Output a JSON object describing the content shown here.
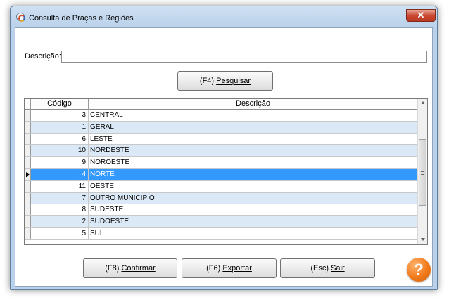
{
  "window": {
    "title": "Consulta de Praças e Regiões",
    "close_label": "✕"
  },
  "search": {
    "label": "Descrição:",
    "value": "",
    "placeholder": "",
    "button_prefix": "(F4) ",
    "button_label": "Pesquisar"
  },
  "grid": {
    "columns": [
      "Código",
      "Descrição"
    ],
    "selected_index": 5,
    "rows": [
      {
        "code": "3",
        "description": "CENTRAL"
      },
      {
        "code": "1",
        "description": "GERAL"
      },
      {
        "code": "6",
        "description": "LESTE"
      },
      {
        "code": "10",
        "description": "NORDESTE"
      },
      {
        "code": "9",
        "description": "NOROESTE"
      },
      {
        "code": "4",
        "description": "NORTE"
      },
      {
        "code": "11",
        "description": "OESTE"
      },
      {
        "code": "7",
        "description": "OUTRO MUNICIPIO"
      },
      {
        "code": "8",
        "description": "SUDESTE"
      },
      {
        "code": "2",
        "description": "SUDOESTE"
      },
      {
        "code": "5",
        "description": "SUL"
      }
    ]
  },
  "footer": {
    "confirm_prefix": "(F8) ",
    "confirm_label": "Confirmar",
    "export_prefix": "(F6) ",
    "export_label": "Exportar",
    "exit_prefix": "(Esc) ",
    "exit_label": "Sair",
    "help_label": "?"
  },
  "icons": {
    "app": "app-logo-icon",
    "close": "close-icon",
    "row_indicator": "row-pointer-icon",
    "scroll_up": "scroll-up-arrow-icon",
    "scroll_down": "scroll-down-arrow-icon",
    "help": "help-icon"
  },
  "colors": {
    "selection": "#3399ff",
    "alt_row": "#dbe8f6",
    "close_button": "#c9452e",
    "help_button": "#f07a1c"
  }
}
